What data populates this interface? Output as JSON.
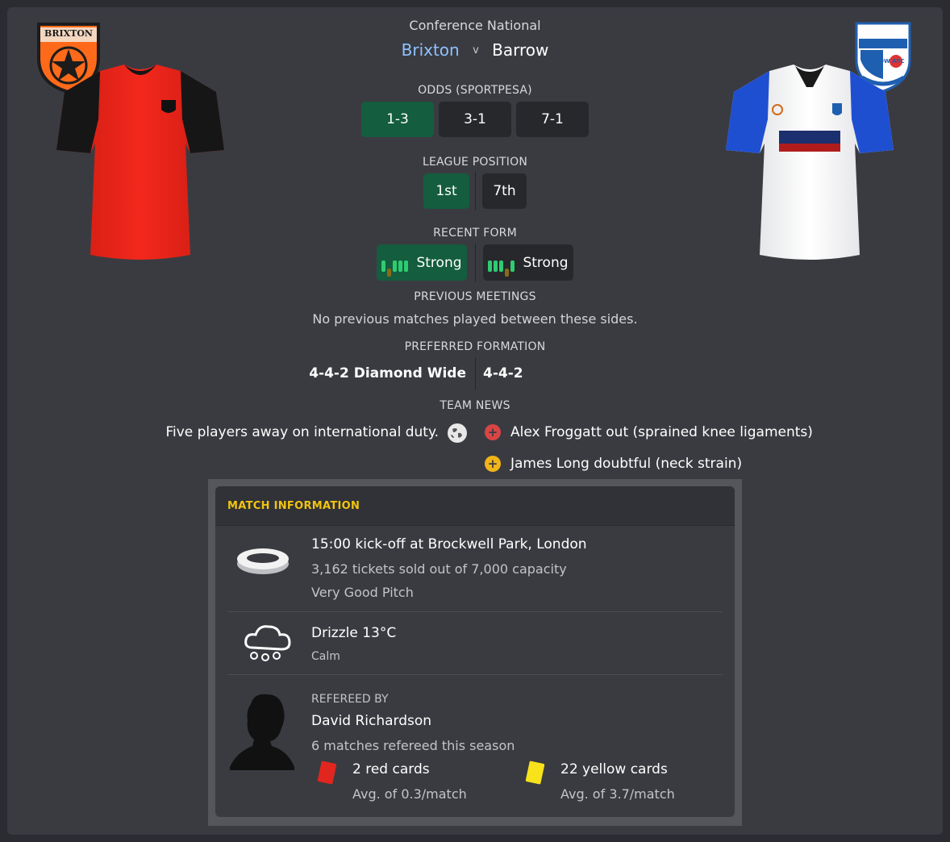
{
  "match": {
    "competition": "Conference National",
    "home_team": "Brixton",
    "vs": "v",
    "away_team": "Barrow",
    "home_badge_text": "BRIXTON",
    "away_badge_text": "BARROW AFC"
  },
  "odds": {
    "heading": "ODDS (SPORTPESA)",
    "home": "1-3",
    "draw": "3-1",
    "away": "7-1"
  },
  "league_position": {
    "heading": "LEAGUE POSITION",
    "home": "1st",
    "away": "7th"
  },
  "recent_form": {
    "heading": "RECENT FORM",
    "home": "Strong",
    "away": "Strong"
  },
  "previous_meetings": {
    "heading": "PREVIOUS MEETINGS",
    "text": "No previous matches played between these sides."
  },
  "preferred_formation": {
    "heading": "PREFERRED FORMATION",
    "home": "4-4-2 Diamond Wide",
    "away": "4-4-2"
  },
  "team_news": {
    "heading": "TEAM NEWS",
    "home_item": "Five players away on international duty.",
    "away_items": [
      {
        "text": "Alex Froggatt out (sprained knee ligaments)",
        "icon": "injury-out-icon"
      },
      {
        "text": "James Long doubtful (neck strain)",
        "icon": "doubtful-icon"
      }
    ]
  },
  "match_info": {
    "title": "MATCH INFORMATION",
    "venue_line": "15:00 kick-off at Brockwell Park, London",
    "tickets": "3,162 tickets sold out of 7,000 capacity",
    "pitch": "Very Good Pitch",
    "weather": "Drizzle 13°C",
    "wind": "Calm",
    "referee_label": "REFEREED BY",
    "referee_name": "David Richardson",
    "referee_matches": "6 matches refereed this season",
    "red_cards": "2 red cards",
    "red_avg": "Avg. of 0.3/match",
    "yellow_cards": "22 yellow cards",
    "yellow_avg": "Avg. of 3.7/match"
  },
  "colors": {
    "panel": "#3a3b41",
    "highlight_green": "#145d3e",
    "accent_yellow": "#f1c40f",
    "home_name": "#8fc2ff"
  }
}
